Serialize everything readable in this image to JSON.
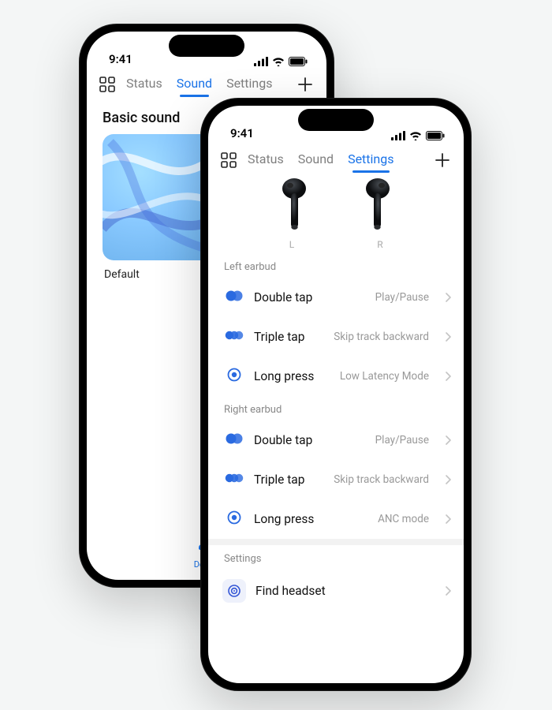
{
  "status_time": "9:41",
  "phoneA": {
    "tabs": [
      "Status",
      "Sound",
      "Settings"
    ],
    "active_tab_index": 1,
    "section_title": "Basic sound",
    "card_label": "Default",
    "tabbar_label": "Device"
  },
  "phoneB": {
    "tabs": [
      "Status",
      "Sound",
      "Settings"
    ],
    "active_tab_index": 2,
    "earbud_labels": {
      "left": "L",
      "right": "R"
    },
    "left_header": "Left earbud",
    "right_header": "Right earbud",
    "gestures_left": [
      {
        "icon": "double",
        "label": "Double tap",
        "value": "Play/Pause"
      },
      {
        "icon": "triple",
        "label": "Triple tap",
        "value": "Skip track backward"
      },
      {
        "icon": "long",
        "label": "Long press",
        "value": "Low Latency Mode"
      }
    ],
    "gestures_right": [
      {
        "icon": "double",
        "label": "Double tap",
        "value": "Play/Pause"
      },
      {
        "icon": "triple",
        "label": "Triple tap",
        "value": "Skip track backward"
      },
      {
        "icon": "long",
        "label": "Long press",
        "value": "ANC mode"
      }
    ],
    "settings_header": "Settings",
    "find_label": "Find headset"
  },
  "colors": {
    "accent": "#1a73e8"
  }
}
